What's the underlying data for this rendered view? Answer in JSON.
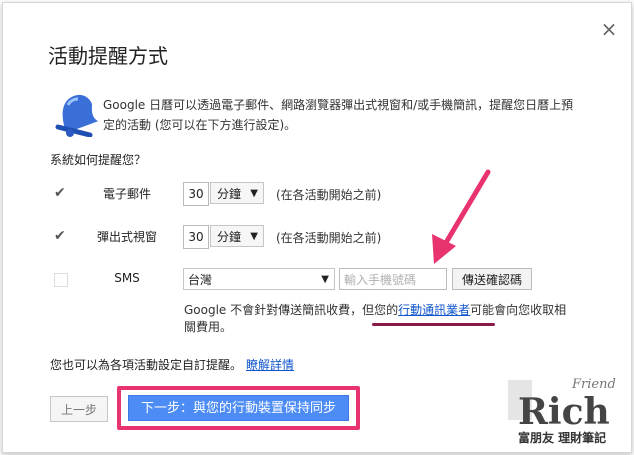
{
  "dialog": {
    "title": "活動提醒方式",
    "close_label": "×",
    "intro": "Google 日曆可以透過電子郵件、網路瀏覽器彈出式視窗和/或手機簡訊，提醒您日曆上預定的活動 (您可以在下方進行設定)。",
    "question": "系統如何提醒您？"
  },
  "reminders": [
    {
      "label": "電子郵件",
      "checked": true,
      "value": "30",
      "unit": "分鐘",
      "note": "(在各活動開始之前)"
    },
    {
      "label": "彈出式視窗",
      "checked": true,
      "value": "30",
      "unit": "分鐘",
      "note": "(在各活動開始之前)"
    }
  ],
  "sms": {
    "label": "SMS",
    "country": "台灣",
    "phone_placeholder": "輸入手機號碼",
    "send_button": "傳送確認碼",
    "note_before": "Google 不會針對傳送簡訊收費，但您的",
    "note_link": "行動通訊業者",
    "note_after": "可能會向您收取相關費用。"
  },
  "custom": {
    "text": "您也可以為各項活動設定自訂提醒。",
    "link": "瞭解詳情"
  },
  "buttons": {
    "prev": "上一步",
    "next": "下一步：與您的行動裝置保持同步"
  },
  "watermark": {
    "word_top": "Friend",
    "word_main": "Rich",
    "caption": "富朋友 理財筆記"
  },
  "colors": {
    "accent_blue": "#4d8cf4",
    "highlight_pink": "#e8336e",
    "link_blue": "#1155cc"
  }
}
